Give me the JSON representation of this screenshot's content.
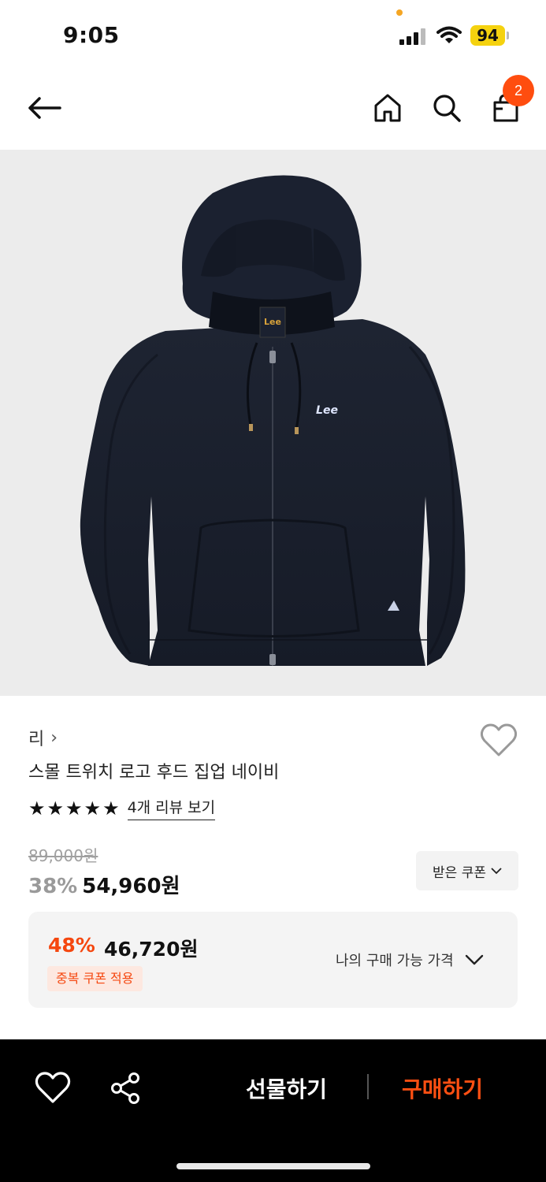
{
  "status_bar": {
    "time": "9:05",
    "battery": "94"
  },
  "header": {
    "back_icon": "arrow-left-icon",
    "home_icon": "home-icon",
    "search_icon": "search-icon",
    "cart_icon": "shopping-bag-icon",
    "cart_count": "2"
  },
  "product": {
    "image_alt": "navy zip-up hoodie",
    "brand": "리",
    "brand_chevron": "›",
    "name": "스몰 트위치 로고 후드 집업 네이비",
    "rating_stars": 5,
    "review_link": "4개 리뷰 보기",
    "original_price": "89,000원",
    "discount_rate": "38%",
    "sale_price": "54,960원",
    "coupon_button": "받은 쿠폰"
  },
  "best_price": {
    "discount_rate": "48%",
    "price": "46,720원",
    "badge": "중복 쿠폰 적용",
    "my_price_label": "나의 구매 가능 가격"
  },
  "bottom_bar": {
    "gift_label": "선물하기",
    "buy_label": "구매하기"
  },
  "colors": {
    "accent": "#f5470f",
    "badge": "#ff4d0f",
    "battery": "#f5d20f"
  }
}
